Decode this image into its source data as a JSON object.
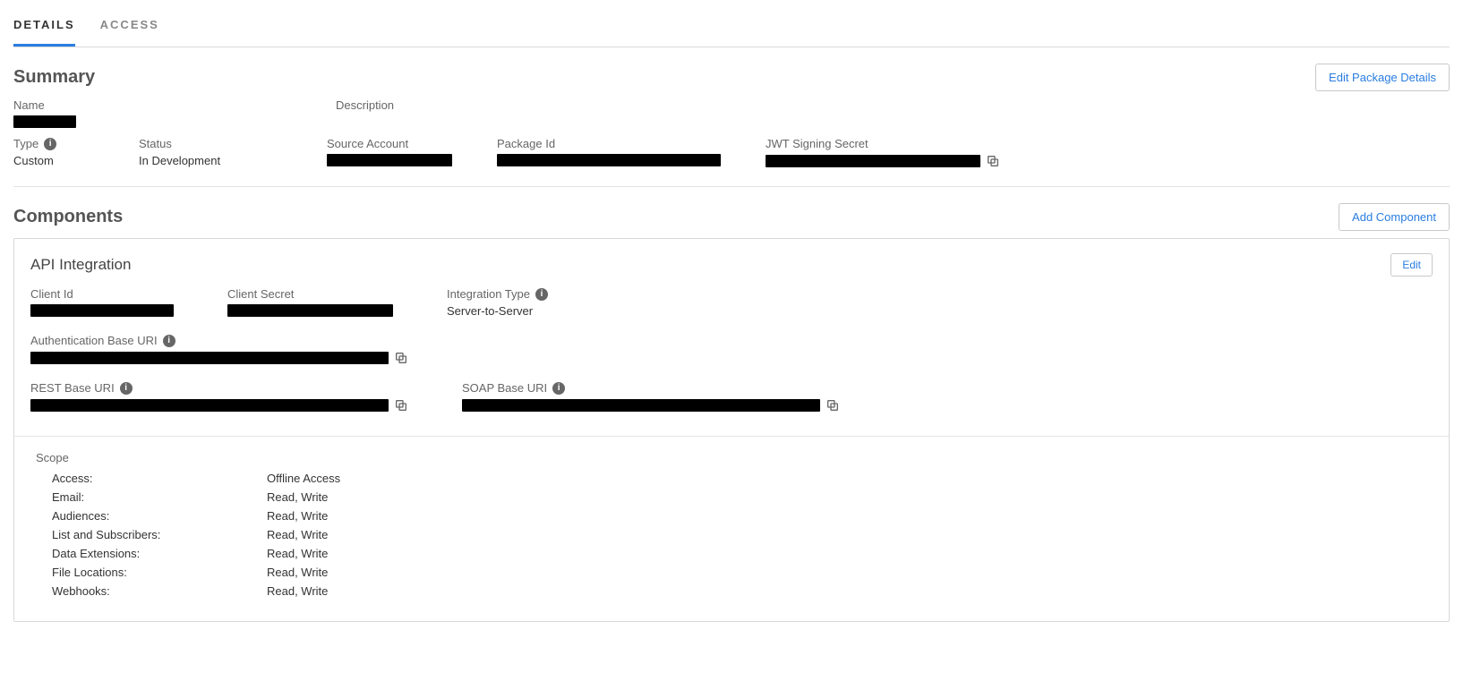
{
  "tabs": {
    "details": "DETAILS",
    "access": "ACCESS",
    "active": "details"
  },
  "summary": {
    "title": "Summary",
    "editBtn": "Edit Package Details",
    "fields": {
      "name_label": "Name",
      "description_label": "Description",
      "type_label": "Type",
      "type_value": "Custom",
      "status_label": "Status",
      "status_value": "In Development",
      "sourceAccount_label": "Source Account",
      "packageId_label": "Package Id",
      "jwt_label": "JWT Signing Secret"
    }
  },
  "components": {
    "title": "Components",
    "addBtn": "Add Component",
    "api": {
      "title": "API Integration",
      "editBtn": "Edit",
      "clientId_label": "Client Id",
      "clientSecret_label": "Client Secret",
      "integrationType_label": "Integration Type",
      "integrationType_value": "Server-to-Server",
      "authBase_label": "Authentication Base URI",
      "restBase_label": "REST Base URI",
      "soapBase_label": "SOAP Base URI"
    },
    "scope": {
      "title": "Scope",
      "rows": [
        {
          "k": "Access:",
          "v": "Offline Access"
        },
        {
          "k": "Email:",
          "v": "Read, Write"
        },
        {
          "k": "Audiences:",
          "v": "Read, Write"
        },
        {
          "k": "List and Subscribers:",
          "v": "Read, Write"
        },
        {
          "k": "Data Extensions:",
          "v": "Read, Write"
        },
        {
          "k": "File Locations:",
          "v": "Read, Write"
        },
        {
          "k": "Webhooks:",
          "v": "Read, Write"
        }
      ]
    }
  }
}
